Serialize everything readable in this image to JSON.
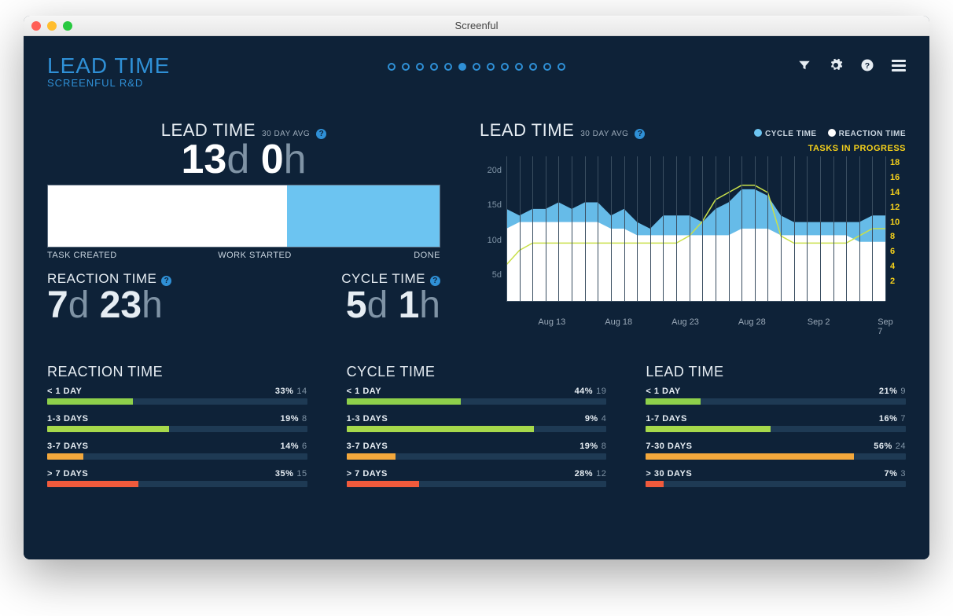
{
  "window": {
    "title": "Screenful"
  },
  "header": {
    "title": "LEAD TIME",
    "subtitle": "SCREENFUL R&D",
    "pager": {
      "count": 13,
      "active": 5
    }
  },
  "lead_summary": {
    "title": "LEAD TIME",
    "subtitle": "30 DAY AVG",
    "days": "13",
    "hours": "0",
    "labels": {
      "left": "TASK CREATED",
      "mid": "WORK STARTED",
      "right": "DONE"
    },
    "reaction": {
      "title": "REACTION TIME",
      "days": "7",
      "hours": "23",
      "fraction": 0.61
    },
    "cycle": {
      "title": "CYCLE TIME",
      "days": "5",
      "hours": "1",
      "fraction": 0.39
    }
  },
  "chart_data": {
    "type": "area",
    "title": "LEAD TIME",
    "subtitle": "30 DAY AVG",
    "legend": {
      "cycle": "CYCLE TIME",
      "reaction": "REACTION TIME"
    },
    "tip_label": "TASKS IN PROGRESS",
    "ylabel": "days",
    "ylim": [
      0,
      22
    ],
    "y_ticks": [
      "20d",
      "15d",
      "10d",
      "5d"
    ],
    "y2_ticks": [
      "18",
      "16",
      "14",
      "12",
      "10",
      "8",
      "6",
      "4",
      "2"
    ],
    "x_ticks": [
      "Aug 13",
      "Aug 18",
      "Aug 23",
      "Aug 28",
      "Sep 2",
      "Sep 7"
    ],
    "n_points": 30,
    "series": [
      {
        "name": "LEAD TIME (stacked top)",
        "color": "#6cc4f1",
        "values": [
          14,
          13,
          14,
          14,
          15,
          14,
          15,
          15,
          13,
          14,
          12,
          11,
          13,
          13,
          13,
          12,
          14,
          15,
          17,
          17,
          16,
          13,
          12,
          12,
          12,
          12,
          12,
          12,
          13,
          13
        ]
      },
      {
        "name": "REACTION TIME (white area)",
        "color": "#ffffff",
        "values": [
          11,
          12,
          12,
          12,
          12,
          12,
          12,
          12,
          11,
          11,
          10,
          10,
          10,
          10,
          10,
          10,
          10,
          10,
          11,
          11,
          11,
          10,
          10,
          10,
          10,
          10,
          10,
          9,
          9,
          9
        ]
      },
      {
        "name": "TASKS IN PROGRESS (line, right axis)",
        "color": "#c9e04a",
        "values": [
          5,
          7,
          8,
          8,
          8,
          8,
          8,
          8,
          8,
          8,
          8,
          8,
          8,
          8,
          9,
          11,
          14,
          15,
          16,
          16,
          15,
          9,
          8,
          8,
          8,
          8,
          8,
          9,
          10,
          10
        ]
      }
    ]
  },
  "distributions": [
    {
      "title": "REACTION TIME",
      "rows": [
        {
          "label": "< 1 DAY",
          "pct": "33%",
          "count": "14",
          "fill": 33,
          "color": "#8ed04b"
        },
        {
          "label": "1-3 DAYS",
          "pct": "19%",
          "count": "8",
          "fill": 47,
          "color": "#a6d94b"
        },
        {
          "label": "3-7 DAYS",
          "pct": "14%",
          "count": "6",
          "fill": 14,
          "color": "#f3a83c"
        },
        {
          "label": "> 7 DAYS",
          "pct": "35%",
          "count": "15",
          "fill": 35,
          "color": "#f05a3c"
        }
      ]
    },
    {
      "title": "CYCLE TIME",
      "rows": [
        {
          "label": "< 1 DAY",
          "pct": "44%",
          "count": "19",
          "fill": 44,
          "color": "#8ed04b"
        },
        {
          "label": "1-3 DAYS",
          "pct": "9%",
          "count": "4",
          "fill": 72,
          "color": "#a6d94b"
        },
        {
          "label": "3-7 DAYS",
          "pct": "19%",
          "count": "8",
          "fill": 19,
          "color": "#f3a83c"
        },
        {
          "label": "> 7 DAYS",
          "pct": "28%",
          "count": "12",
          "fill": 28,
          "color": "#f05a3c"
        }
      ]
    },
    {
      "title": "LEAD TIME",
      "rows": [
        {
          "label": "< 1 DAY",
          "pct": "21%",
          "count": "9",
          "fill": 21,
          "color": "#8ed04b"
        },
        {
          "label": "1-7 DAYS",
          "pct": "16%",
          "count": "7",
          "fill": 48,
          "color": "#a6d94b"
        },
        {
          "label": "7-30 DAYS",
          "pct": "56%",
          "count": "24",
          "fill": 80,
          "color": "#f3a83c"
        },
        {
          "label": "> 30 DAYS",
          "pct": "7%",
          "count": "3",
          "fill": 7,
          "color": "#f05a3c"
        }
      ]
    }
  ]
}
